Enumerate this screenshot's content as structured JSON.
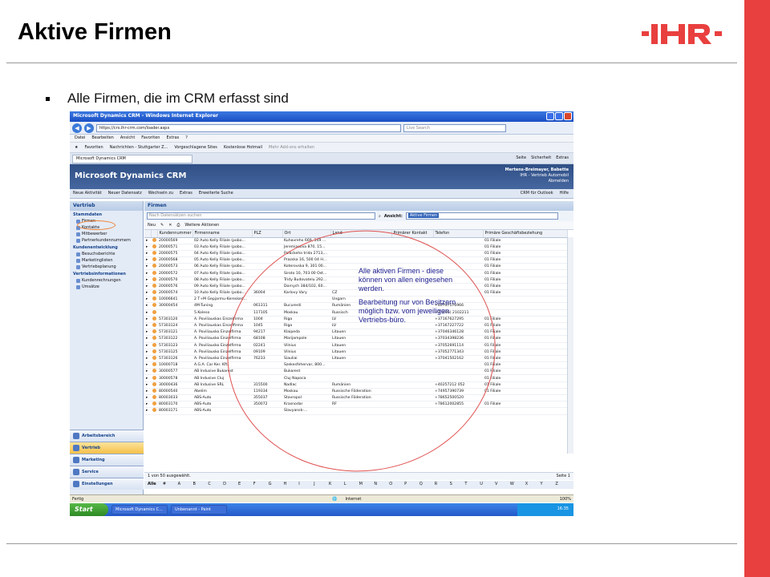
{
  "slide": {
    "title": "Aktive Firmen",
    "bullet": "Alle Firmen, die im CRM erfasst sind",
    "logo": "IHR"
  },
  "ie": {
    "title": "Microsoft Dynamics CRM - Windows Internet Explorer",
    "url": "https://crs.ihr-crm.com/loader.aspx",
    "search_placeholder": "Live Search",
    "menu": [
      "Datei",
      "Bearbeiten",
      "Ansicht",
      "Favoriten",
      "Extras",
      "?"
    ],
    "favorites": [
      "Favoriten",
      "Nachrichten - Stuttgarter Z...",
      "Vorgeschlagene Sites",
      "Kostenlose Hotmail",
      "Mehr Add-ons erhalten"
    ],
    "tab": "Microsoft Dynamics CRM",
    "tools": [
      "Seite",
      "Sicherheit",
      "Extras"
    ],
    "status_left": "Fertig",
    "status_zone": "Internet",
    "zoom": "100%"
  },
  "crm": {
    "brand": "Microsoft Dynamics CRM",
    "user": "Mertens-Breimayer, Babette",
    "org": "IHR - Vertrieb Automobil",
    "abmelden": "Abmelden",
    "menu": [
      "Neue Aktivität",
      "Neuer Datensatz",
      "Wechseln zu",
      "Extras",
      "Erweiterte Suche"
    ],
    "menu_right": [
      "CRM für Outlook",
      "Hilfe"
    ]
  },
  "sidebar": {
    "head": "Vertrieb",
    "sections": [
      {
        "title": "Stammdaten",
        "items": [
          "Firmen",
          "Kontakte",
          "Mitbewerber",
          "Partnerkundennummern"
        ]
      },
      {
        "title": "Kundenentwicklung",
        "items": [
          "Besuchsberichte",
          "Marketinglisten",
          "Vertriebsplanung"
        ]
      },
      {
        "title": "Vertriebsinformationen",
        "items": [
          "Kundenrechnungen",
          "Umsätze"
        ]
      }
    ],
    "wunderbar": [
      "Arbeitsbereich",
      "Vertrieb",
      "Marketing",
      "Service",
      "Einstellungen"
    ]
  },
  "main": {
    "title": "Firmen",
    "search_placeholder": "Nach Datensätzen suchen",
    "view_label": "Ansicht:",
    "view_value": "Aktive Firmen",
    "toolbar": [
      "Neu",
      "Weitere Aktionen"
    ],
    "columns": [
      "Kundennummer",
      "Firmenname",
      "PLZ",
      "Ort",
      "Land",
      "Primärer Kontakt",
      "Telefon",
      "Primäre Geschäftsbeziehung"
    ],
    "rows": [
      [
        "20000569",
        "02 Auto Kelly Filiale (pobo...",
        "",
        "Kuhavreho 669, 149 ...",
        "",
        "",
        "",
        "01 Filiale"
      ],
      [
        "20000571",
        "03 Auto Kelly Filiale (pobo...",
        "",
        "Jeremiasova 870, 15...",
        "",
        "",
        "",
        "01 Filiale"
      ],
      [
        "20000575",
        "04 Auto Kelly Filiale (pobo...",
        "",
        "Palackeho trida 2713,...",
        "",
        "",
        "",
        "01 Filiale"
      ],
      [
        "20000568",
        "05 Auto Kelly Filiale (pobo...",
        "",
        "Prazska 16, 500 04 H...",
        "",
        "",
        "",
        "01 Filiale"
      ],
      [
        "20000573",
        "06 Auto Kelly Filiale (pobo...",
        "",
        "Koterovska 9, 301 00...",
        "",
        "",
        "",
        "01 Filiale"
      ],
      [
        "20000572",
        "07 Auto Kelly Filiale (pobo...",
        "",
        "Siroto 10, 703 00 Ost...",
        "",
        "",
        "",
        "01 Filiale"
      ],
      [
        "20000570",
        "08 Auto Kelly Filiale (pobo...",
        "",
        "Tridy Budovatelu 292...",
        "",
        "",
        "",
        "01 Filiale"
      ],
      [
        "20000576",
        "09 Auto Kelly Filiale (pobo...",
        "",
        "Dornych 384/102, 60...",
        "",
        "",
        "",
        "01 Filiale"
      ],
      [
        "20000574",
        "10 Auto Kelly Filiale (pobo...",
        "36004",
        "Karlovy Vary",
        "CZ",
        "",
        "",
        "01 Filiale"
      ],
      [
        "10006641",
        "2 T+M Gepjarmu-Keresked...",
        "",
        "",
        "Ungarn",
        "",
        "",
        ""
      ],
      [
        "30000454",
        "4M-Tuning",
        "061311",
        "Bucuresti",
        "Rumänien",
        "",
        "+40747176966",
        ""
      ],
      [
        "",
        "5.Koleso",
        "117105",
        "Moskau",
        "Russisch",
        "",
        "+7 (495) 2102211",
        ""
      ],
      [
        "57303120",
        "A. Poviliauskas Einzelfirma",
        "1004",
        "Riga",
        "LV",
        "",
        "+37167627295",
        "01 Filiale"
      ],
      [
        "57303124",
        "A. Poviliauskas Einzelfirma",
        "1045",
        "Riga",
        "LV",
        "",
        "+37167227722",
        "01 Filiale"
      ],
      [
        "57303121",
        "A. Poviliausko Einzelfirma",
        "94217",
        "Klaipeda",
        "Litauen",
        "",
        "+37046346128",
        "01 Filiale"
      ],
      [
        "57303122",
        "A. Poviliausko Einzelfirma",
        "68108",
        "Marijampole",
        "Litauen",
        "",
        "+37034398236",
        "01 Filiale"
      ],
      [
        "57303123",
        "A. Poviliausko Einzelfirma",
        "02241",
        "Vilnius",
        "Litauen",
        "",
        "+37052691114",
        "01 Filiale"
      ],
      [
        "57303125",
        "A. Poviliausko Einzelfirma",
        "09109",
        "Vilnius",
        "Litauen",
        "",
        "+37052771343",
        "01 Filiale"
      ],
      [
        "57303126",
        "A. Poviliausko Einzelfirma",
        "76233",
        "Siauliai",
        "Litauen",
        "",
        "+37041502162",
        "01 Filiale"
      ],
      [
        "10000718",
        "A.G.A. Car Ker. Kft.",
        "",
        "Szekesfehervar, 800...",
        "",
        "",
        "",
        "01 Filiale"
      ],
      [
        "30000577",
        "AB Indusive Bukarest",
        "",
        "Bukarest",
        "",
        "",
        "",
        "01 Filiale"
      ],
      [
        "30000578",
        "AB Indusive Cluj",
        "",
        "Cluj Napoca",
        "",
        "",
        "",
        "01 Filiale"
      ],
      [
        "30000436",
        "AB Indusive SRL",
        "315500",
        "Nadlac",
        "Rumänien",
        "",
        "+40257212 052",
        "01 Filiale"
      ],
      [
        "80000540",
        "Abelim",
        "119334",
        "Moskau",
        "Russische Föderation",
        "",
        "+74957390739",
        "01 Filiale"
      ],
      [
        "80003033",
        "ABS-Auto",
        "355037",
        "Stavropol",
        "Russische Föderation",
        "",
        "+78652500520",
        ""
      ],
      [
        "80003170",
        "ABS-Auto",
        "350072",
        "Krasnodar",
        "RF",
        "",
        "+78612002855",
        "01 Filiale"
      ],
      [
        "80003171",
        "ABS-Auto",
        "",
        "Slavyansk-...",
        "",
        "",
        "",
        ""
      ]
    ],
    "status": "1 von 50 ausgewählt.",
    "page": "Seite 1",
    "alphabet": [
      "Alle",
      "#",
      "A",
      "B",
      "C",
      "D",
      "E",
      "F",
      "G",
      "H",
      "I",
      "J",
      "K",
      "L",
      "M",
      "N",
      "O",
      "P",
      "Q",
      "R",
      "S",
      "T",
      "U",
      "V",
      "W",
      "X",
      "Y",
      "Z"
    ]
  },
  "annotation": {
    "line1": "Alle aktiven Firmen - diese können von allen eingesehen werden.",
    "line2": "Bearbeitung nur von Besitzern möglich bzw. vom jeweiligen Vertriebs-büro."
  },
  "taskbar": {
    "start": "Start",
    "buttons": [
      "Microsoft Dynamics C...",
      "Unbenannt - Paint"
    ],
    "clock": "16:35"
  },
  "colors": {
    "brand_red": "#e8403f",
    "crm_blue": "#2f4f86",
    "annotation": "#1a1a8c"
  }
}
